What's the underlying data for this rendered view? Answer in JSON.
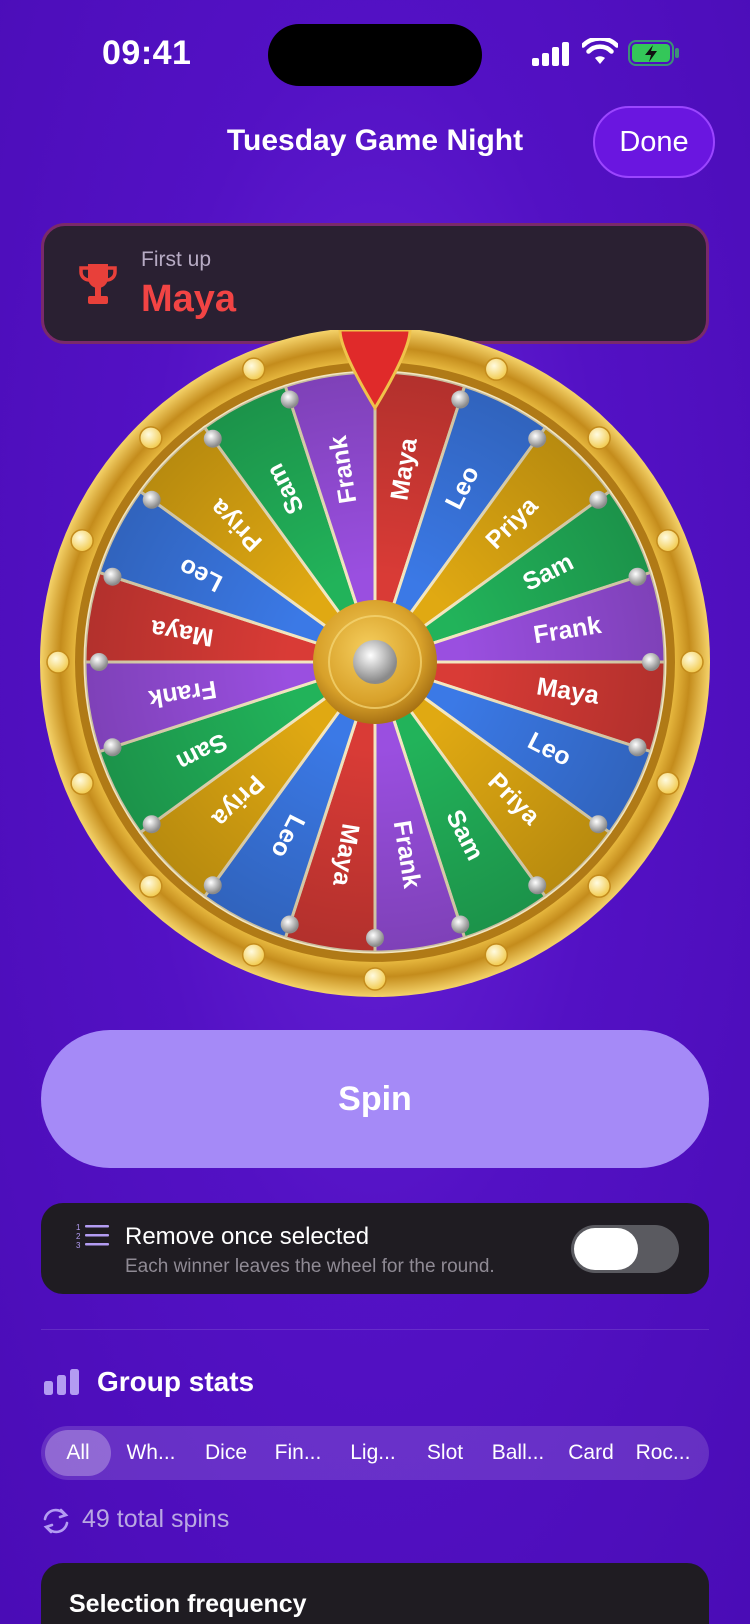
{
  "status": {
    "time": "09:41"
  },
  "nav": {
    "title": "Tuesday Game Night",
    "done_label": "Done"
  },
  "winner": {
    "label": "First up",
    "name": "Maya"
  },
  "wheel": {
    "segments": [
      {
        "name": "Maya",
        "color": "#d93b36"
      },
      {
        "name": "Leo",
        "color": "#3b79e6"
      },
      {
        "name": "Priya",
        "color": "#e0a912"
      },
      {
        "name": "Sam",
        "color": "#22b35a"
      },
      {
        "name": "Frank",
        "color": "#9a4fe0"
      },
      {
        "name": "Maya",
        "color": "#d93b36"
      },
      {
        "name": "Leo",
        "color": "#3b79e6"
      },
      {
        "name": "Priya",
        "color": "#e0a912"
      },
      {
        "name": "Sam",
        "color": "#22b35a"
      },
      {
        "name": "Frank",
        "color": "#9a4fe0"
      },
      {
        "name": "Maya",
        "color": "#d93b36"
      },
      {
        "name": "Leo",
        "color": "#3b79e6"
      },
      {
        "name": "Priya",
        "color": "#e0a912"
      },
      {
        "name": "Sam",
        "color": "#22b35a"
      },
      {
        "name": "Frank",
        "color": "#9a4fe0"
      },
      {
        "name": "Maya",
        "color": "#d93b36"
      },
      {
        "name": "Leo",
        "color": "#3b79e6"
      },
      {
        "name": "Priya",
        "color": "#e0a912"
      },
      {
        "name": "Sam",
        "color": "#22b35a"
      },
      {
        "name": "Frank",
        "color": "#9a4fe0"
      }
    ],
    "rim_color": "#d9a42a",
    "pointer_color": "#e02a2a"
  },
  "spin": {
    "label": "Spin"
  },
  "remove_option": {
    "title": "Remove once selected",
    "subtitle": "Each winner leaves the wheel for the round.",
    "enabled": false
  },
  "stats": {
    "title": "Group stats",
    "filters": [
      "All",
      "Wh...",
      "Dice",
      "Fin...",
      "Lig...",
      "Slot",
      "Ball...",
      "Card",
      "Roc..."
    ],
    "selected_filter": "All",
    "total_spins": "49 total spins"
  },
  "frequency": {
    "title": "Selection frequency"
  }
}
